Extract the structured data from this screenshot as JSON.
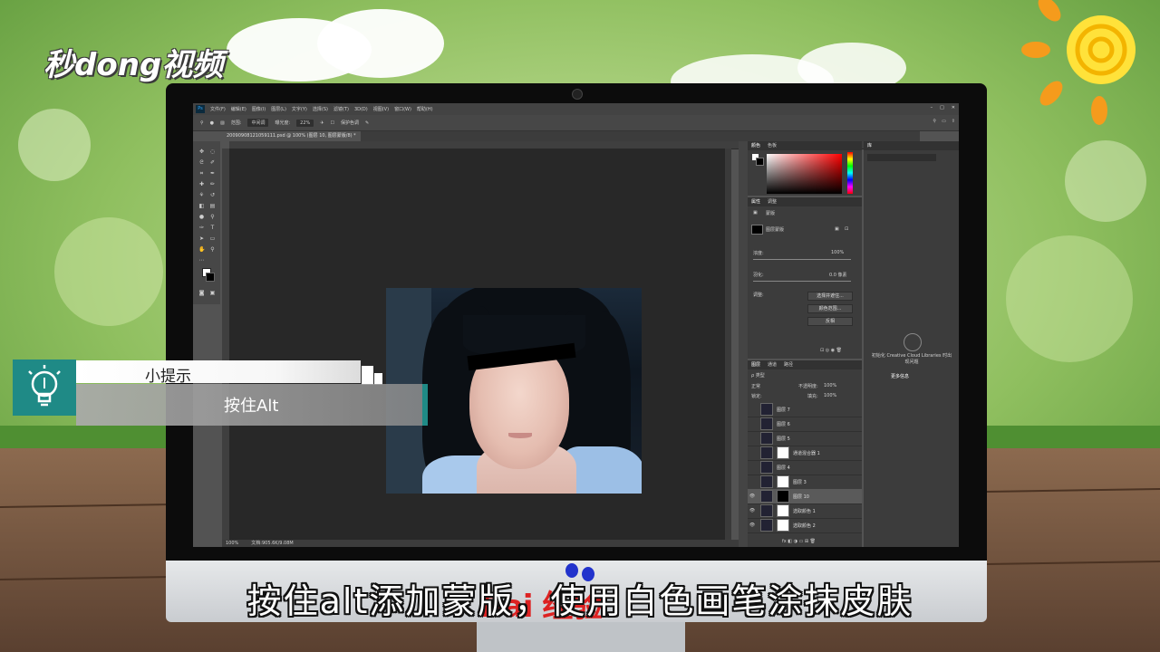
{
  "logo": "秒dong视频",
  "menu": [
    "文件(F)",
    "编辑(E)",
    "图像(I)",
    "图层(L)",
    "文字(Y)",
    "选择(S)",
    "滤镜(T)",
    "3D(D)",
    "视图(V)",
    "窗口(W)",
    "帮助(H)"
  ],
  "options": {
    "mode_label": "范围:",
    "mode_value": "中间调",
    "exposure_label": "曝光度:",
    "exposure_value": "22%",
    "protect_label": "保护色调"
  },
  "document_tab": "20090908121059111.psd @ 100% (图层 10, 图层蒙版/8) *",
  "status": {
    "zoom": "100%",
    "doc": "文档:905.6K/9.08M"
  },
  "panels": {
    "color_tabs": [
      "颜色",
      "色板"
    ],
    "library_tab": "库",
    "properties_tabs": [
      "属性",
      "调整"
    ],
    "properties_title": "蒙版",
    "mask_name": "图层蒙版",
    "density_label": "浓度:",
    "density_value": "100%",
    "feather_label": "羽化:",
    "feather_value": "0.0 像素",
    "adjust_label": "调整:",
    "btn_select_mask": "选择并遮住...",
    "btn_color_range": "颜色范围...",
    "btn_invert": "反相",
    "layers_tabs": [
      "图层",
      "通道",
      "路径"
    ],
    "kind_filter": "ρ 类型",
    "blend_mode": "正常",
    "opacity_label": "不透明度:",
    "opacity_value": "100%",
    "lock_label": "锁定:",
    "fill_label": "填充:",
    "fill_value": "100%",
    "library_msg": "初始化 Creative Cloud Libraries 时出现问题",
    "library_link": "更多信息"
  },
  "layers": [
    {
      "name": "图层 7",
      "visible": false,
      "mask": false
    },
    {
      "name": "图层 6",
      "visible": false,
      "mask": false
    },
    {
      "name": "图层 5",
      "visible": false,
      "mask": false
    },
    {
      "name": "通道混合器 1",
      "visible": false,
      "mask": true
    },
    {
      "name": "图层 4",
      "visible": false,
      "mask": false
    },
    {
      "name": "图层 3",
      "visible": false,
      "mask": true
    },
    {
      "name": "图层 10",
      "visible": true,
      "mask": true,
      "selected": true
    },
    {
      "name": "选取颜色 1",
      "visible": true,
      "mask": true
    },
    {
      "name": "选取颜色 2",
      "visible": true,
      "mask": true
    }
  ],
  "tip": {
    "title": "小提示",
    "body": "按住Alt"
  },
  "subtitle": "按住alt添加蒙版，使用白色画笔涂抹皮肤",
  "watermark": "Bai 经验"
}
